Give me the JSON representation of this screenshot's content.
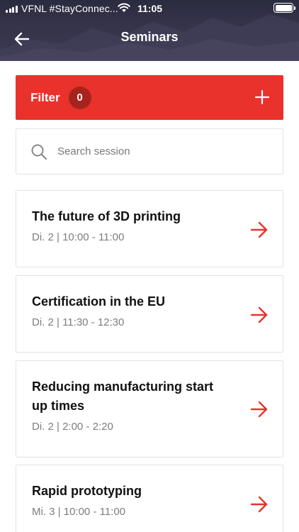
{
  "status_bar": {
    "carrier": "VFNL #StayConnec...",
    "time": "11:05"
  },
  "header": {
    "title": "Seminars",
    "back_icon": "arrow-left-icon"
  },
  "filter": {
    "label": "Filter",
    "count": "0",
    "add_icon": "plus-icon",
    "color": "#e8322b",
    "badge_color": "#a8231e"
  },
  "search": {
    "placeholder": "Search session",
    "value": ""
  },
  "sessions": [
    {
      "title": "The future of 3D printing",
      "time": "Di. 2 | 10:00 - 11:00"
    },
    {
      "title": "Certification in the EU",
      "time": "Di. 2 | 11:30 - 12:30"
    },
    {
      "title": "Reducing manufacturing start up times",
      "time": "Di. 2 | 2:00 - 2:20"
    },
    {
      "title": "Rapid prototyping",
      "time": "Mi. 3 | 10:00 - 11:00"
    }
  ],
  "accent_color": "#e8322b"
}
